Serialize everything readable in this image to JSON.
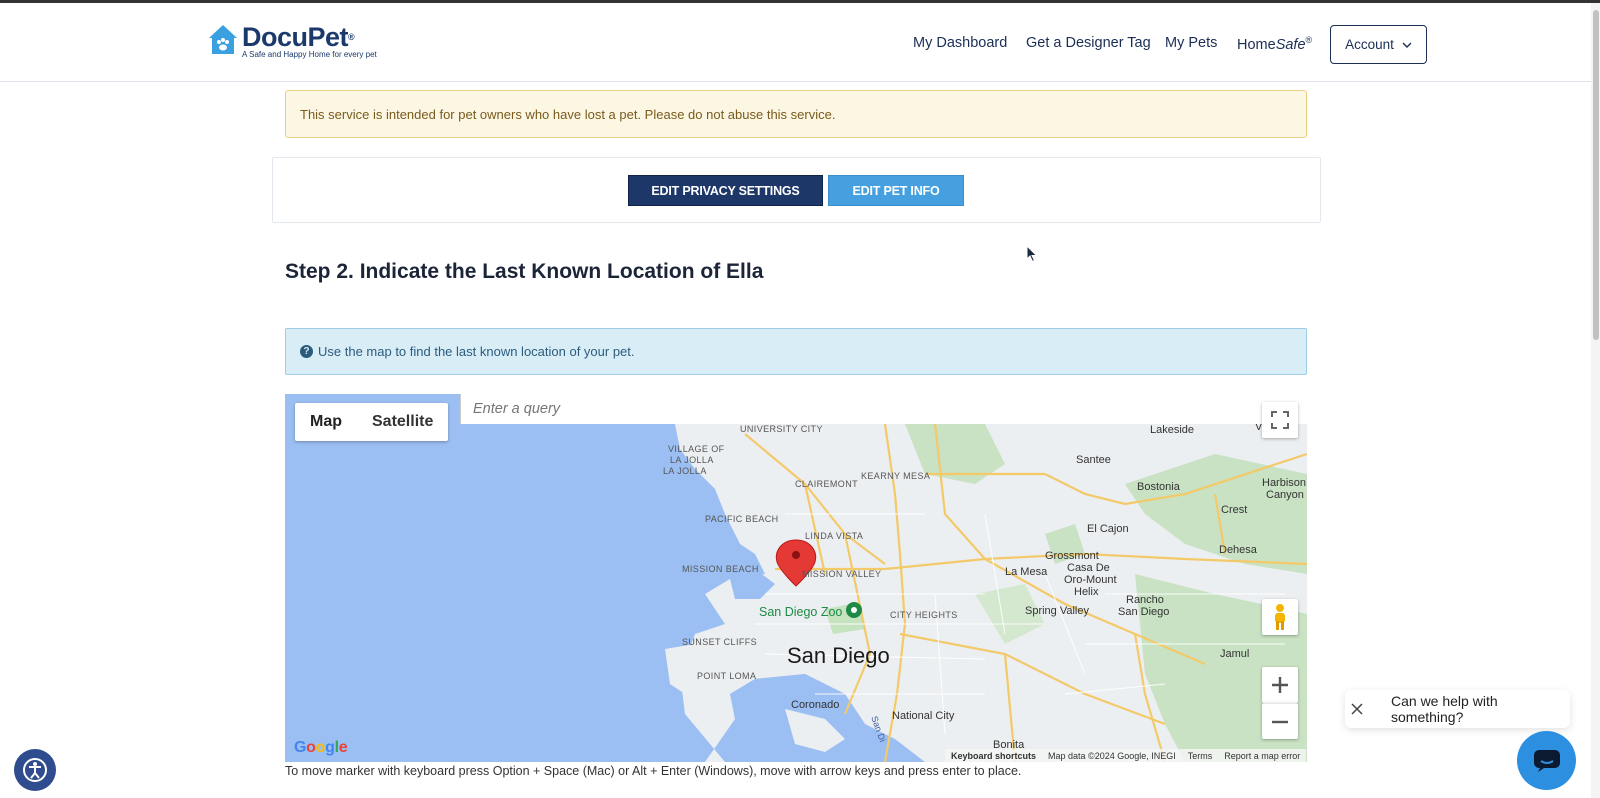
{
  "header": {
    "logo_name": "DocuPet",
    "logo_tm": "®",
    "logo_tagline": "A Safe and Happy Home for every pet",
    "nav": {
      "dashboard": "My Dashboard",
      "designer_tag": "Get a Designer Tag",
      "my_pets": "My Pets",
      "homesafe_prefix": "Home",
      "homesafe_italic": "Safe",
      "homesafe_reg": "®"
    },
    "account_label": "Account"
  },
  "warning_text": "This service is intended for pet owners who have lost a pet. Please do not abuse this service.",
  "buttons": {
    "edit_privacy": "EDIT PRIVACY SETTINGS",
    "edit_pet_info": "EDIT PET INFO"
  },
  "step_title": "Step 2. Indicate the Last Known Location of Ella",
  "info_text": "Use the map to find the last known location of your pet.",
  "map": {
    "type_map": "Map",
    "type_satellite": "Satellite",
    "query_placeholder": "Enter a query",
    "google": "Google",
    "attribution": {
      "shortcuts": "Keyboard shortcuts",
      "data": "Map data ©2024 Google, INEGI",
      "terms": "Terms",
      "report": "Report a map error"
    },
    "labels": {
      "san_diego": "San Diego",
      "zoo": "San Diego Zoo",
      "university_city": "UNIVERSITY CITY",
      "village_la_jolla": "VILLAGE OF",
      "la_jolla": "LA JOLLA",
      "la_jolla_2": "LA JOLLA",
      "clairemont": "CLAIREMONT",
      "kearny_mesa": "KEARNY MESA",
      "pacific_beach": "PACIFIC BEACH",
      "linda_vista": "LINDA VISTA",
      "mission_beach": "MISSION BEACH",
      "mission_valley": "MISSION VALLEY",
      "city_heights": "CITY HEIGHTS",
      "sunset_cliffs": "SUNSET CLIFFS",
      "point_loma": "POINT LOMA",
      "coronado": "Coronado",
      "national_city": "National City",
      "bonita": "Bonita",
      "santee": "Santee",
      "lakeside": "Lakeside",
      "bostonia": "Bostonia",
      "harbison_canyon": "Harbison",
      "harbison_canyon_2": "Canyon",
      "crest": "Crest",
      "el_cajon": "El Cajon",
      "dehesa": "Dehesa",
      "grossmont": "Grossmont",
      "la_mesa": "La Mesa",
      "casa_de_oro": "Casa De",
      "casa_de_oro_2": "Oro-Mount",
      "casa_de_oro_3": "Helix",
      "spring_valley": "Spring Valley",
      "rancho_sd": "Rancho",
      "rancho_sd_2": "San Diego",
      "jamul": "Jamul",
      "valley": "Valley",
      "sd_bay": "San Di"
    }
  },
  "keyboard_note": "To move marker with keyboard press Option + Space (Mac) or Alt + Enter (Windows), move with arrow keys and press enter to place.",
  "chat": {
    "prompt": "Can we help with something?"
  },
  "colors": {
    "brand_navy": "#1c3768",
    "brand_blue": "#46a0df",
    "water": "#9bbff3",
    "marker": "#e53935"
  }
}
